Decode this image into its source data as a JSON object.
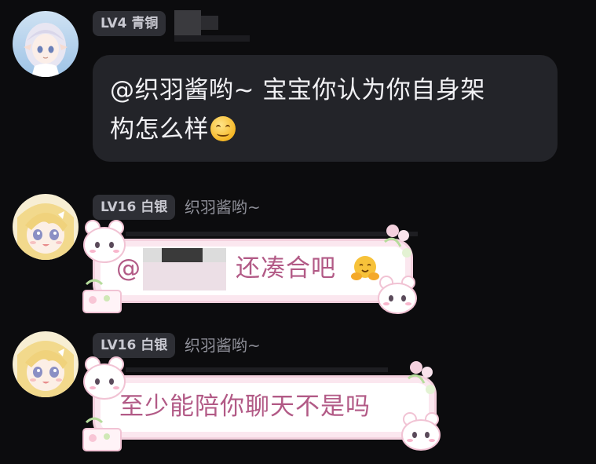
{
  "messages": [
    {
      "level_badge": "LV4 青铜",
      "sender": "",
      "text_line1": "@织羽酱哟~ 宝宝你认为你自身架",
      "text_line2": "构怎么样",
      "emoji": "smiling-face-icon"
    },
    {
      "level_badge": "LV16 白银",
      "sender": "织羽酱哟~",
      "mention_prefix": "@",
      "text": "还凑合吧",
      "emoji": "hugging-face-icon"
    },
    {
      "level_badge": "LV16 白银",
      "sender": "织羽酱哟~",
      "text": "至少能陪你聊天不是吗"
    }
  ],
  "colors": {
    "background": "#0c0c0e",
    "bubble": "#232429",
    "badge": "#2e2f35",
    "sticker_text": "#b25a86",
    "sticker_border": "#f4d1de"
  }
}
